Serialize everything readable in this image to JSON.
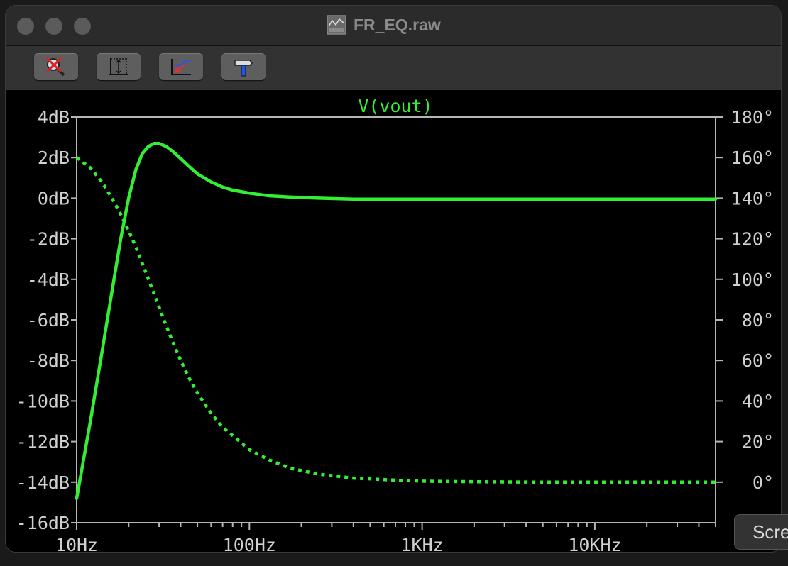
{
  "window": {
    "title": "FR_EQ.raw"
  },
  "toolbar": {
    "buttons": [
      {
        "name": "zoom-cancel",
        "icon": "magnifier-cross-icon"
      },
      {
        "name": "autorange",
        "icon": "autorange-icon"
      },
      {
        "name": "zoom-back",
        "icon": "zoom-back-icon"
      },
      {
        "name": "tools",
        "icon": "hammer-icon"
      }
    ]
  },
  "overlay": {
    "screen_button_label": "Scre"
  },
  "colors": {
    "trace": "#33ee33",
    "axis": "#b5b5b5",
    "label": "#d0d0d0",
    "background": "#000000"
  },
  "chart_data": {
    "type": "line",
    "title": "V(vout)",
    "x_scale": "log",
    "x_ticks": [
      "10Hz",
      "100Hz",
      "1KHz",
      "10KHz"
    ],
    "xlim": [
      10,
      50000
    ],
    "y_left_ticks": [
      "4dB",
      "2dB",
      "0dB",
      "-2dB",
      "-4dB",
      "-6dB",
      "-8dB",
      "-10dB",
      "-12dB",
      "-14dB",
      "-16dB"
    ],
    "ylim_left": [
      -16,
      4
    ],
    "y_right_ticks": [
      "180°",
      "160°",
      "140°",
      "120°",
      "100°",
      "80°",
      "60°",
      "40°",
      "20°",
      "0°"
    ],
    "ylim_right": [
      -20,
      180
    ],
    "grid": false,
    "series": [
      {
        "axis": "left",
        "style": "solid",
        "x": [
          10,
          12,
          14,
          16,
          18,
          20,
          22,
          24,
          26,
          28,
          30,
          33,
          36,
          40,
          45,
          50,
          60,
          70,
          80,
          100,
          130,
          170,
          250,
          400,
          1000,
          5000,
          50000
        ],
        "y": [
          -14.8,
          -11.0,
          -7.6,
          -4.6,
          -2.0,
          0.0,
          1.4,
          2.2,
          2.55,
          2.7,
          2.7,
          2.55,
          2.3,
          1.95,
          1.55,
          1.2,
          0.8,
          0.55,
          0.4,
          0.25,
          0.12,
          0.06,
          0.0,
          -0.05,
          -0.05,
          -0.05,
          -0.05
        ]
      },
      {
        "axis": "right",
        "style": "dotted",
        "x": [
          10,
          12,
          14,
          16,
          18,
          20,
          22,
          25,
          28,
          32,
          36,
          40,
          45,
          50,
          60,
          70,
          80,
          100,
          130,
          170,
          250,
          400,
          700,
          1000,
          2000,
          5000,
          50000
        ],
        "y": [
          160,
          155,
          148,
          140,
          132,
          124,
          116,
          104,
          93,
          80,
          69,
          60,
          51,
          44,
          34,
          27,
          23,
          16,
          11,
          7,
          4,
          2,
          1,
          0.5,
          0.2,
          0,
          0
        ]
      }
    ]
  }
}
